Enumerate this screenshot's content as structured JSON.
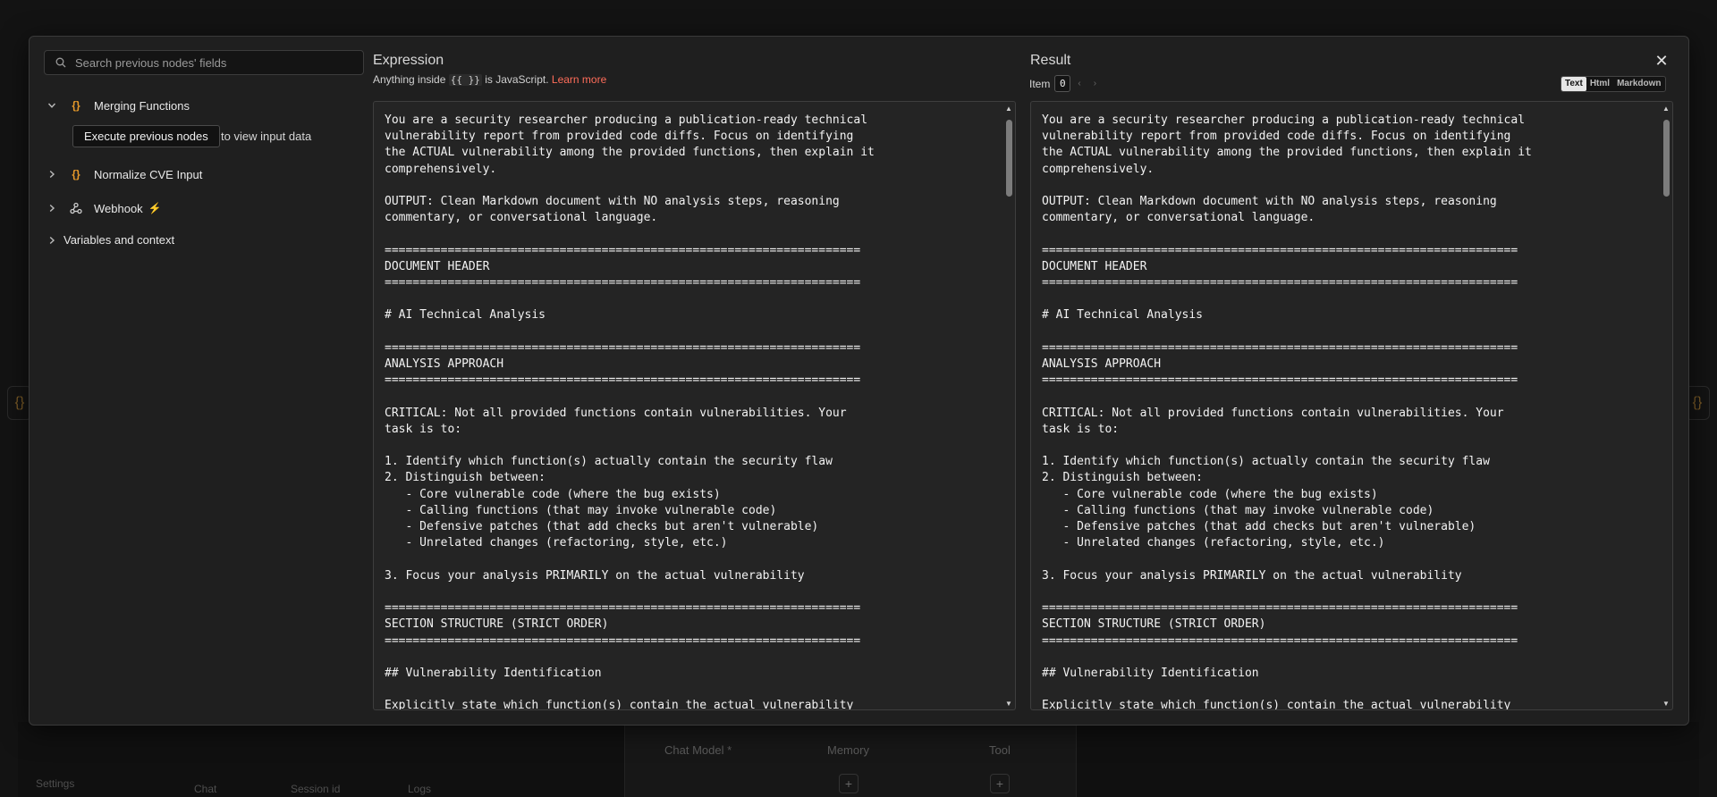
{
  "background": {
    "ai_agent_labels": [
      "Chat Model *",
      "Memory",
      "Tool"
    ],
    "bottom_tabs": [
      "Chat",
      "Session id",
      "Logs"
    ],
    "settings_label": "Settings",
    "node_icon_glyph": "{}"
  },
  "left": {
    "search_placeholder": "Search previous nodes' fields",
    "tree": [
      {
        "label": "Merging Functions",
        "icon": "braces-icon",
        "expanded": true
      },
      {
        "label": "Normalize CVE Input",
        "icon": "braces-icon",
        "expanded": false
      },
      {
        "label": "Webhook",
        "icon": "webhook-icon",
        "expanded": false
      },
      {
        "label": "Variables and context",
        "expanded": false
      }
    ],
    "execute_button": "Execute previous nodes",
    "execute_hint": "to view input data",
    "node_icon_glyph": "{}",
    "bolt_glyph": "⚡"
  },
  "expression": {
    "title": "Expression",
    "hint_prefix": "Anything inside",
    "hint_code": "{{ }}",
    "hint_suffix": "is JavaScript.",
    "learn_more": "Learn more"
  },
  "result": {
    "title": "Result",
    "item_label": "Item",
    "item_value": "0",
    "view_modes": [
      "Text",
      "Html",
      "Markdown"
    ],
    "active_view": "Text"
  },
  "prompt_text": "You are a security researcher producing a publication-ready technical\nvulnerability report from provided code diffs. Focus on identifying\nthe ACTUAL vulnerability among the provided functions, then explain it\ncomprehensively.\n\nOUTPUT: Clean Markdown document with NO analysis steps, reasoning\ncommentary, or conversational language.\n\n====================================================================\nDOCUMENT HEADER\n====================================================================\n\n# AI Technical Analysis\n\n====================================================================\nANALYSIS APPROACH\n====================================================================\n\nCRITICAL: Not all provided functions contain vulnerabilities. Your\ntask is to:\n\n1. Identify which function(s) actually contain the security flaw\n2. Distinguish between:\n   - Core vulnerable code (where the bug exists)\n   - Calling functions (that may invoke vulnerable code)\n   - Defensive patches (that add checks but aren't vulnerable)\n   - Unrelated changes (refactoring, style, etc.)\n\n3. Focus your analysis PRIMARILY on the actual vulnerability\n\n====================================================================\nSECTION STRUCTURE (STRICT ORDER)\n====================================================================\n\n## Vulnerability Identification\n\nExplicitly state which function(s) contain the actual vulnerability",
  "colors": {
    "accent": "#ff6d5a",
    "node_icon": "#e89a2a",
    "panel": "#1f1f1f",
    "code_bg": "#242424"
  }
}
